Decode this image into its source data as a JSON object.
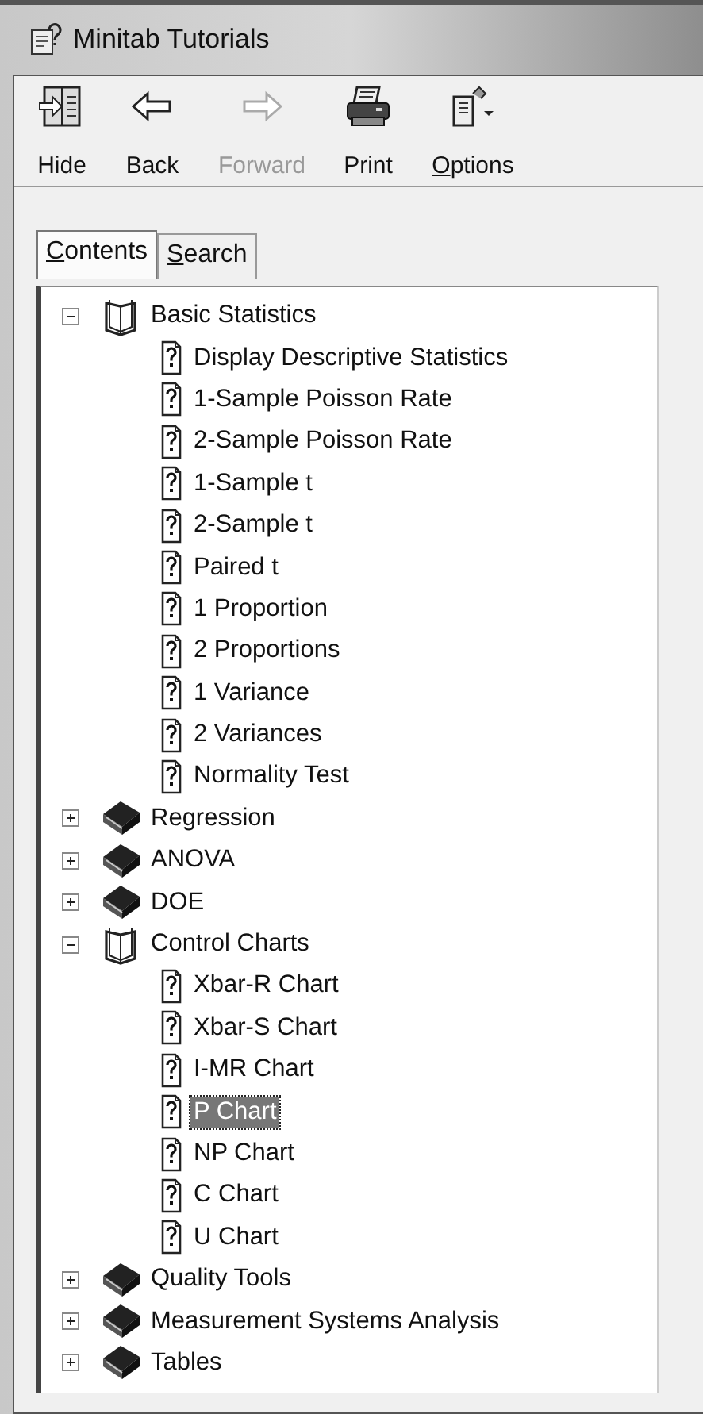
{
  "window": {
    "title": "Minitab Tutorials"
  },
  "toolbar": [
    {
      "kind": "hide",
      "label": "Hide",
      "disabled": false,
      "underline_first": false
    },
    {
      "kind": "back",
      "label": "Back",
      "disabled": false,
      "underline_first": false
    },
    {
      "kind": "forward",
      "label": "Forward",
      "disabled": true,
      "underline_first": false
    },
    {
      "kind": "print",
      "label": "Print",
      "disabled": false,
      "underline_first": false
    },
    {
      "kind": "options",
      "label": "Options",
      "disabled": false,
      "underline_first": true
    }
  ],
  "tabs": [
    {
      "label": "Contents",
      "selected": true,
      "underline_first": true
    },
    {
      "label": "Search",
      "selected": false,
      "underline_first": true
    }
  ],
  "tree": [
    {
      "label": "Basic Statistics",
      "expanded": true,
      "children": [
        {
          "label": "Display Descriptive Statistics",
          "selected": false
        },
        {
          "label": "1-Sample Poisson Rate",
          "selected": false
        },
        {
          "label": "2-Sample Poisson Rate",
          "selected": false
        },
        {
          "label": "1-Sample t",
          "selected": false
        },
        {
          "label": "2-Sample t",
          "selected": false
        },
        {
          "label": "Paired t",
          "selected": false
        },
        {
          "label": "1 Proportion",
          "selected": false
        },
        {
          "label": "2 Proportions",
          "selected": false
        },
        {
          "label": "1 Variance",
          "selected": false
        },
        {
          "label": "2 Variances",
          "selected": false
        },
        {
          "label": "Normality Test",
          "selected": false
        }
      ]
    },
    {
      "label": "Regression",
      "expanded": false
    },
    {
      "label": "ANOVA",
      "expanded": false
    },
    {
      "label": "DOE",
      "expanded": false
    },
    {
      "label": "Control Charts",
      "expanded": true,
      "children": [
        {
          "label": "Xbar-R Chart",
          "selected": false
        },
        {
          "label": "Xbar-S Chart",
          "selected": false
        },
        {
          "label": "I-MR Chart",
          "selected": false
        },
        {
          "label": "P Chart",
          "selected": true
        },
        {
          "label": "NP Chart",
          "selected": false
        },
        {
          "label": "C Chart",
          "selected": false
        },
        {
          "label": "U Chart",
          "selected": false
        }
      ]
    },
    {
      "label": "Quality Tools",
      "expanded": false
    },
    {
      "label": "Measurement Systems Analysis",
      "expanded": false
    },
    {
      "label": "Tables",
      "expanded": false
    }
  ]
}
